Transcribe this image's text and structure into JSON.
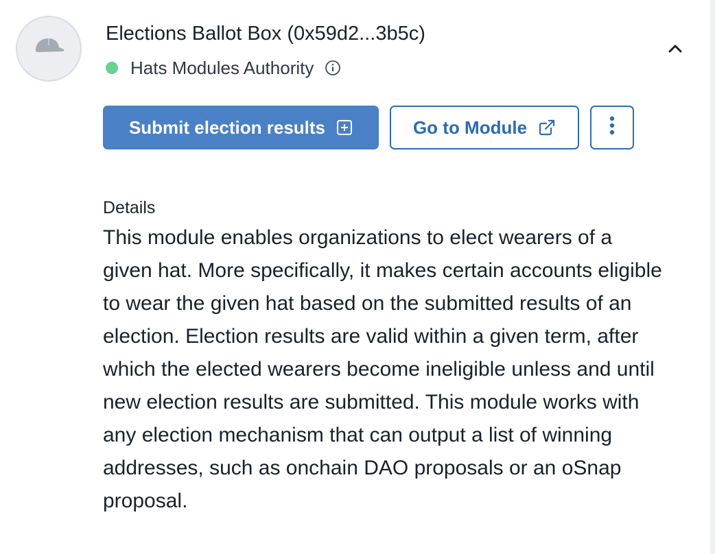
{
  "module": {
    "title": "Elections Ballot Box (0x59d2...3b5c)",
    "authority_label": "Hats Modules Authority",
    "status_color": "#68d391",
    "avatar_icon": "cap-icon",
    "info_icon": "info-circle-icon",
    "collapse_icon": "chevron-up-icon"
  },
  "actions": {
    "submit_label": "Submit election results",
    "submit_icon": "plus-square-icon",
    "goto_label": "Go to Module",
    "goto_icon": "external-link-icon",
    "more_icon": "vertical-dots-icon"
  },
  "details": {
    "heading": "Details",
    "text": "This module enables organizations to elect wearers of a given hat. More specifically, it makes certain accounts eligible to wear the given hat based on the submitted results of an election. Election results are valid within a given term, after which the elected wearers become ineligible unless and until new election results are submitted. This module works with any election mechanism that can output a list of winning addresses, such as onchain DAO proposals or an oSnap proposal."
  },
  "colors": {
    "primary": "#4a80c6",
    "outline": "#2b6cb0",
    "text": "#1a202c"
  }
}
